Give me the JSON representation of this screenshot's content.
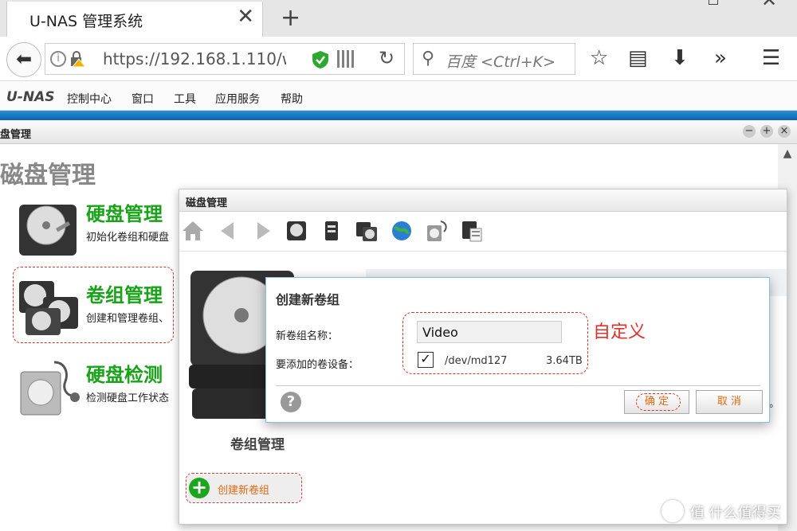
{
  "browser": {
    "tab_title": "U-NAS 管理系统",
    "tab_close": "✕",
    "new_tab": "+",
    "url": "https://192.168.1.110/w",
    "search_placeholder": "百度 <Ctrl+K>",
    "icons": [
      "back-icon",
      "info-icon",
      "lock-warning-icon",
      "shield-icon",
      "qr-code-icon",
      "reload-icon",
      "search-icon",
      "bookmark-star-icon",
      "reading-list-icon",
      "download-icon",
      "overflow-icon",
      "hamburger-menu-icon"
    ]
  },
  "menubar": {
    "brand": "U-NAS",
    "items": [
      "控制中心",
      "窗口",
      "工具",
      "应用服务",
      "帮助"
    ]
  },
  "main_window": {
    "title": "盘管理",
    "controls": [
      "−",
      "+",
      "×"
    ],
    "page_title": "磁盘管理",
    "features": [
      {
        "title": "硬盘管理",
        "desc": "初始化卷组和硬盘"
      },
      {
        "title": "卷组管理",
        "desc": "创建和管理卷组、"
      },
      {
        "title": "硬盘检测",
        "desc": "检测硬盘工作状态"
      }
    ]
  },
  "disk_dialog": {
    "title": "磁盘管理",
    "side_label": "卷组管理",
    "create_button": "创建新卷组",
    "right_partial_text": "。"
  },
  "modal": {
    "title": "创建新卷组",
    "name_label": "新卷组名称：",
    "name_value": "Video",
    "device_label": "要添加的卷设备：",
    "device_checked": true,
    "device_check_mark": "✓",
    "device": "/dev/md127",
    "size": "3.64TB",
    "annotation": "自定义",
    "help": "?",
    "ok": "确 定",
    "cancel": "取 消"
  },
  "watermark": "值 什么值得买",
  "colors": {
    "accent_green": "#19a319",
    "orange": "#e06a10",
    "annotation_red": "#e0302c",
    "top_blue": "#0b63b0"
  }
}
